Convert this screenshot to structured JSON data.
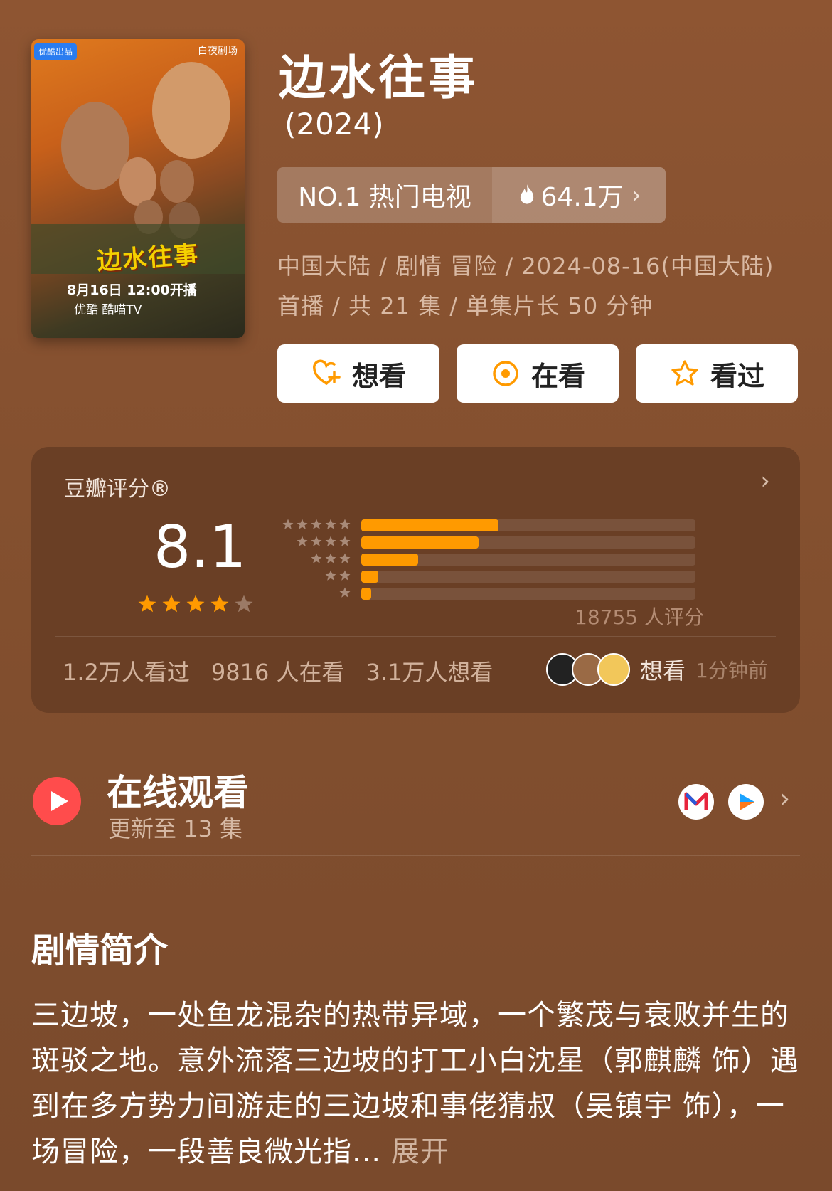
{
  "poster": {
    "badge": "优酷出品",
    "studio": "白夜剧场",
    "title": "边水往事",
    "date_line": "8月16日 12:00开播",
    "platforms": "优酷 酷喵TV"
  },
  "show": {
    "title": "边水往事",
    "year": "(2024)",
    "rank": "NO.1 热门电视",
    "heat": "64.1万",
    "meta": "中国大陆 / 剧情 冒险 / 2024-08-16(中国大陆) 首播 / 共 21 集 / 单集片长 50 分钟"
  },
  "actions": [
    {
      "label": "想看",
      "icon": "heart-plus-icon"
    },
    {
      "label": "在看",
      "icon": "target-circle-icon"
    },
    {
      "label": "看过",
      "icon": "star-outline-icon"
    }
  ],
  "rating": {
    "label": "豆瓣评分®",
    "score": "8.1",
    "stars": 4,
    "distribution": [
      0.41,
      0.35,
      0.17,
      0.05,
      0.03
    ],
    "count": "18755 人评分",
    "stats": [
      "1.2万人看过",
      "9816 人在看",
      "3.1万人想看"
    ],
    "recent_action": "想看",
    "recent_time": "1分钟前",
    "colors": {
      "bar": "#ff9a00",
      "star": "#ff9a00"
    }
  },
  "online": {
    "title": "在线观看",
    "subtitle": "更新至 13 集"
  },
  "synopsis": {
    "title": "剧情简介",
    "text": "三边坡，一处鱼龙混杂的热带异域，一个繁茂与衰败并生的斑驳之地。意外流落三边坡的打工小白沈星（郭麒麟 饰）遇到在多方势力间游走的三边坡和事佬猜叔（吴镇宇 饰），一场冒险，一段善良微光指...",
    "more": "展开"
  }
}
